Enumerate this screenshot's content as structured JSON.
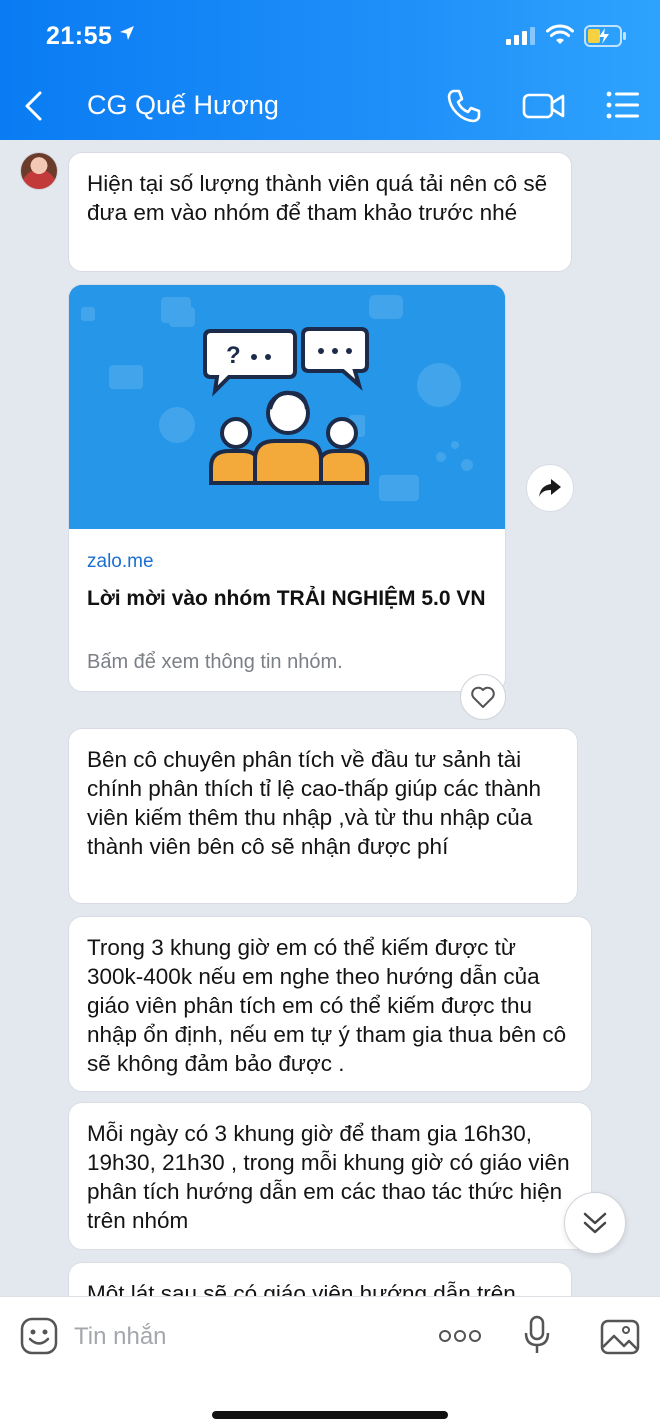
{
  "status_bar": {
    "time": "21:55"
  },
  "header": {
    "title": "CG Quế Hương"
  },
  "messages": [
    {
      "text": "Hiện tại số lượng thành viên quá tải nên cô sẽ đưa em vào nhóm để tham khảo trước nhé"
    },
    {
      "text": "Bên cô chuyên phân tích về đầu tư sảnh tài chính phân thích tỉ lệ cao-thấp giúp các thành viên kiếm thêm thu nhập ,và từ thu nhập của thành viên bên cô sẽ nhận được phí"
    },
    {
      "text": "Trong 3 khung giờ em có thể kiếm được từ 300k-400k nếu em nghe theo hướng dẫn của giáo viên phân tích em có thể kiếm được thu nhập ổn định, nếu em tự ý tham gia thua bên cô sẽ không đảm bảo được ."
    },
    {
      "text": "Mỗi ngày có 3 khung giờ để tham gia 16h30, 19h30, 21h30 , trong mỗi khung giờ có giáo viên phân tích hướng dẫn em các thao tác thức hiện trên nhóm"
    },
    {
      "text": "Một lát sau sẽ có giáo viên hướng dẫn trên"
    }
  ],
  "link_card": {
    "domain": "zalo.me",
    "title": "Lời mời vào nhóm TRẢI NGHIỆM 5.0 VN",
    "description": "Bấm để xem thông tin nhóm."
  },
  "input": {
    "placeholder": "Tin nhắn"
  },
  "colors": {
    "header": "#1a88f6",
    "link": "#1c6fd1",
    "background": "#e3e7ee"
  }
}
